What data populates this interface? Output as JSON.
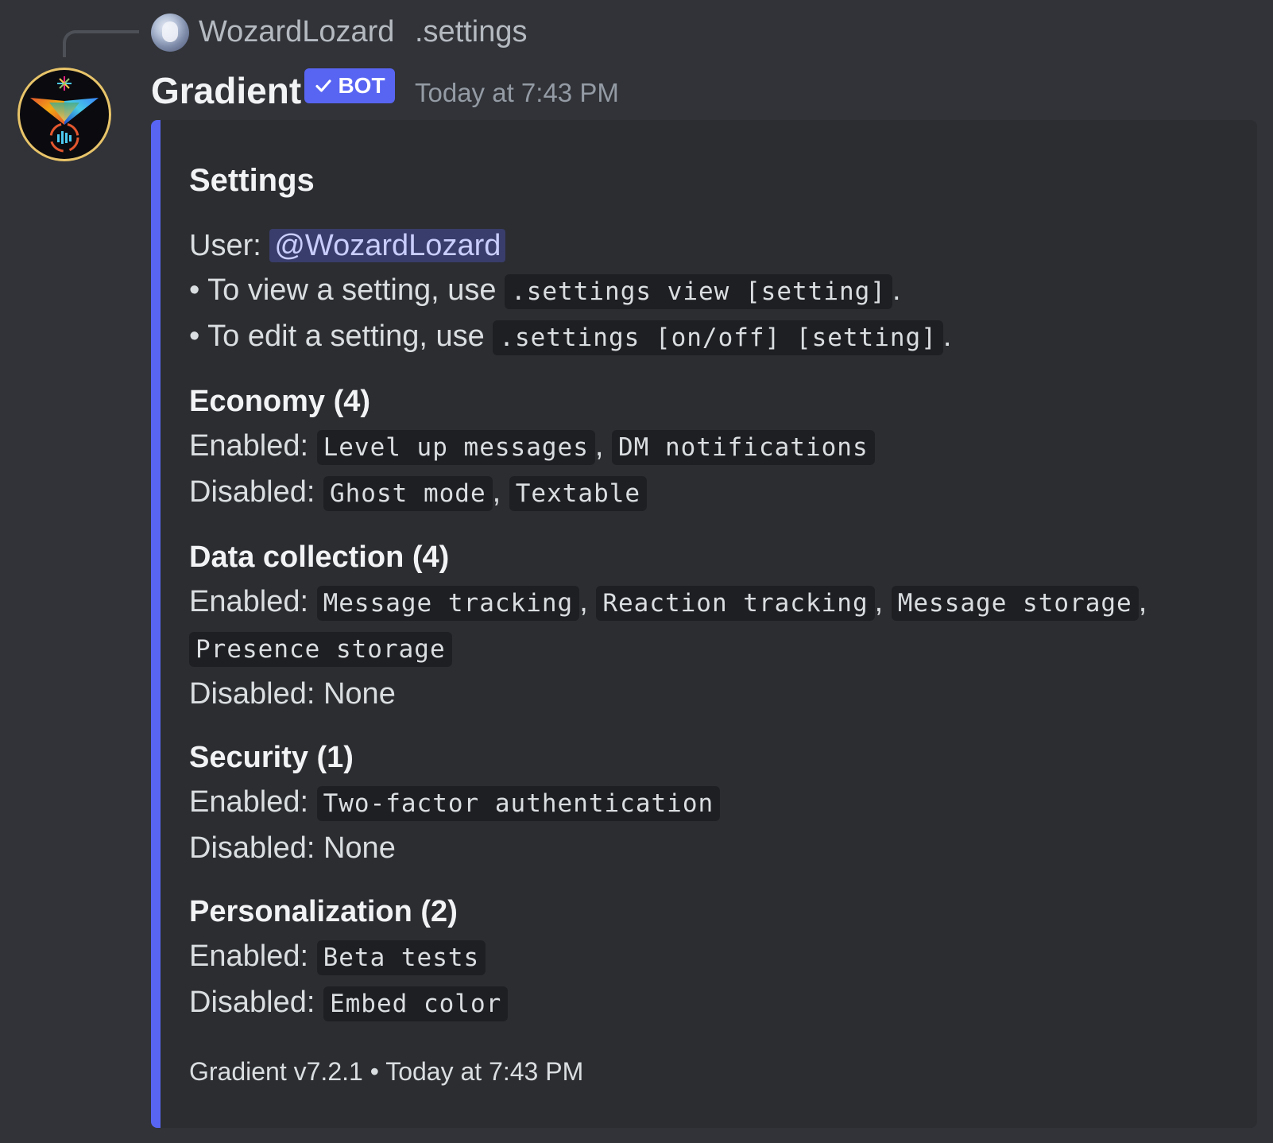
{
  "reply": {
    "author": "WozardLozard",
    "content": ".settings"
  },
  "message": {
    "author": "Gradient",
    "badge": "BOT",
    "timestamp": "Today at 7:43 PM"
  },
  "embed": {
    "accent_color": "#5865f2",
    "title": "Settings",
    "user_label": "User:",
    "user_mention": "@WozardLozard",
    "view_prefix": "• To view a setting, use ",
    "view_command": ".settings view [setting]",
    "edit_prefix": "• To edit a setting, use ",
    "edit_command": ".settings [on/off] [setting]",
    "period": ".",
    "comma": ",",
    "enabled_label": "Enabled: ",
    "disabled_label": "Disabled: ",
    "sections": [
      {
        "heading": "Economy (4)",
        "enabled": [
          "Level up messages",
          "DM notifications"
        ],
        "disabled": [
          "Ghost mode",
          "Textable"
        ],
        "disabled_none": ""
      },
      {
        "heading": "Data collection (4)",
        "enabled": [
          "Message tracking",
          "Reaction tracking",
          "Message storage",
          "Presence storage"
        ],
        "disabled": [],
        "disabled_none": "None"
      },
      {
        "heading": "Security (1)",
        "enabled": [
          "Two-factor authentication"
        ],
        "disabled": [],
        "disabled_none": "None"
      },
      {
        "heading": "Personalization (2)",
        "enabled": [
          "Beta tests"
        ],
        "disabled": [
          "Embed color"
        ],
        "disabled_none": ""
      }
    ],
    "footer": "Gradient v7.2.1 • Today at 7:43 PM"
  }
}
